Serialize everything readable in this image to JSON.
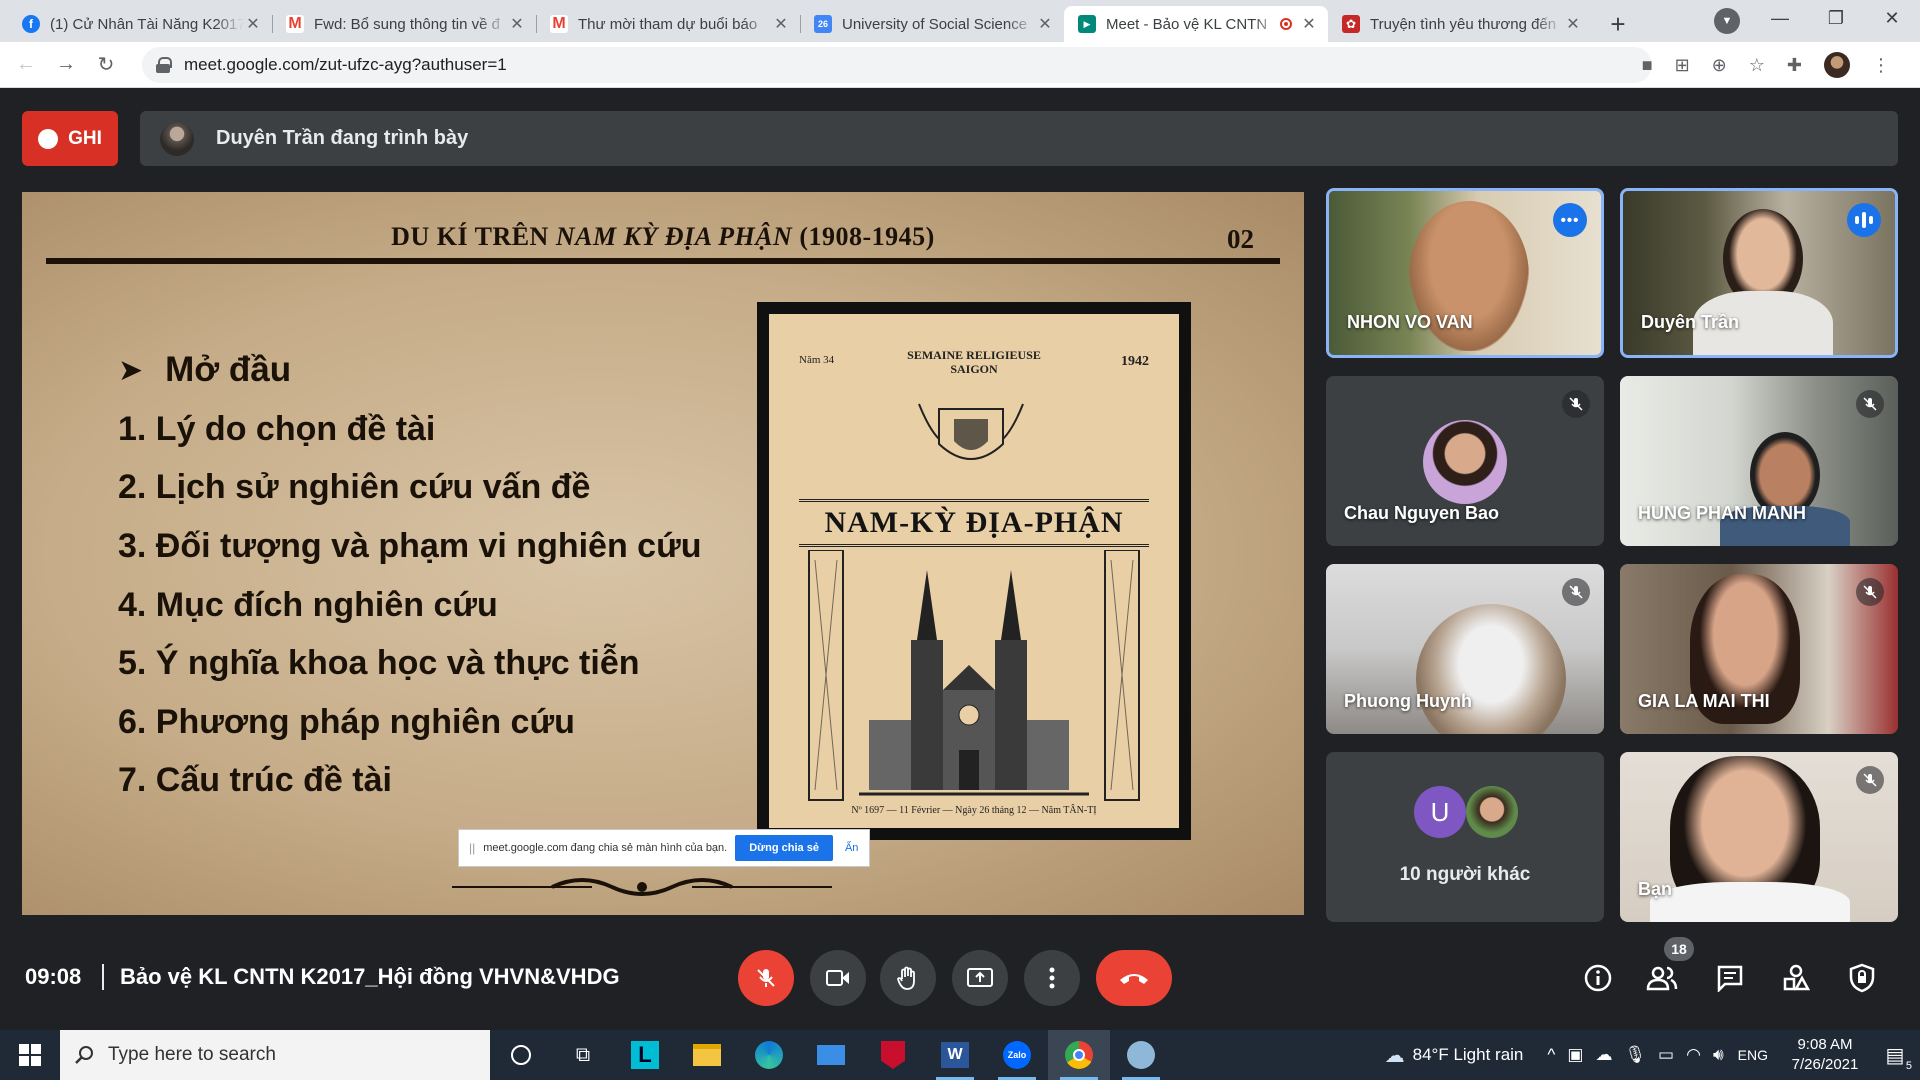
{
  "browser": {
    "tabs": [
      {
        "title": "(1) Cử Nhân Tài Năng K2017",
        "icon": "facebook-icon",
        "color": "#1877f2",
        "glyph": "f"
      },
      {
        "title": "Fwd: Bổ sung thông tin về đ",
        "icon": "gmail-icon",
        "color": "#ea4335",
        "glyph": "M"
      },
      {
        "title": "Thư mời tham dự buổi báo",
        "icon": "gmail-icon",
        "color": "#ea4335",
        "glyph": "M"
      },
      {
        "title": "University of Social Science",
        "icon": "calendar-icon",
        "color": "#4285f4",
        "glyph": "26"
      },
      {
        "title": "Meet - Bảo vệ KL CNTN",
        "icon": "meet-icon",
        "color": "#00897b",
        "glyph": "▶",
        "active": true,
        "recording": true
      },
      {
        "title": "Truyện tình yêu thương đến",
        "icon": "story-icon",
        "color": "#c62828",
        "glyph": "✿"
      }
    ],
    "url": "meet.google.com/zut-ufzc-ayg?authuser=1"
  },
  "meet": {
    "record_label": "GHI",
    "presenting_text": "Duyên Trần đang trình bày",
    "clock": "09:08",
    "meeting_title": "Bảo vệ KL CNTN K2017_Hội đồng VHVN&VHDG",
    "participants_count": "18",
    "others_label": "10 người khác",
    "others_initial": "U"
  },
  "slide": {
    "title_prefix": "DU KÍ TRÊN ",
    "title_italic": "NAM KỲ ĐỊA PHẬN",
    "title_suffix": " (1908-1945)",
    "number": "02",
    "heading": "Mở đầu",
    "items": [
      "1. Lý do chọn đề tài",
      "2. Lịch sử nghiên cứu vấn đề",
      "3. Đối tượng và phạm vi nghiên cứu",
      "4. Mục đích nghiên cứu",
      "5. Ý nghĩa khoa học và thực tiễn",
      "6. Phương pháp nghiên cứu",
      "7. Cấu trúc đề tài"
    ],
    "poster": {
      "top_left": "Năm 34",
      "top_right": "1942",
      "semaine": "SEMAINE RELIGIEUSE",
      "city": "SAIGON",
      "title": "NAM-KỲ ĐỊA-PHẬN",
      "footer": "Nº 1697 — 11 Février — Ngày 26 tháng 12 — Năm TÂN-TỊ"
    },
    "share_bar": {
      "text": "meet.google.com đang chia sẻ màn hình của bạn.",
      "stop": "Dừng chia sẻ",
      "hide": "Ẩn"
    }
  },
  "participants": [
    {
      "name": "NHON VO VAN"
    },
    {
      "name": "Duyên Trần"
    },
    {
      "name": "Chau Nguyen Bao"
    },
    {
      "name": "HUNG PHAN MANH"
    },
    {
      "name": "Phuong Huynh"
    },
    {
      "name": "GIA LA MAI THI"
    },
    {
      "name": "Bạn"
    }
  ],
  "taskbar": {
    "search_placeholder": "Type here to search",
    "weather": "84°F  Light rain",
    "language": "ENG",
    "time": "9:08 AM",
    "date": "7/26/2021",
    "notification_count": "5"
  }
}
